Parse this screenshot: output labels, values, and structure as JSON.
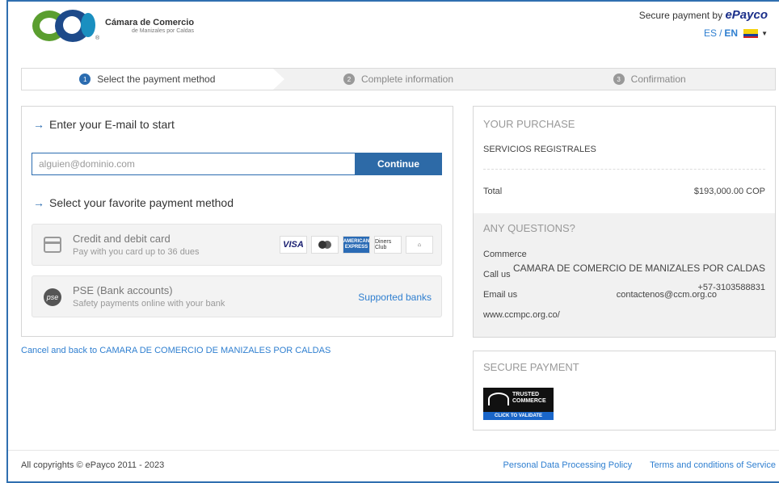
{
  "header": {
    "logo": {
      "name": "Cámara de Comercio",
      "subtitle": "de Manizales por Caldas",
      "reg": "®"
    },
    "secure_prefix": "Secure payment by",
    "secure_brand": "ePayco",
    "lang_es": "ES",
    "lang_sep": "/",
    "lang_en": "EN",
    "flag_icon": "colombia-flag-icon"
  },
  "steps": [
    {
      "num": "1",
      "label": "Select the payment method",
      "active": true
    },
    {
      "num": "2",
      "label": "Complete information",
      "active": false
    },
    {
      "num": "3",
      "label": "Confirmation",
      "active": false
    }
  ],
  "main": {
    "email_title": "Enter your E-mail to start",
    "email_placeholder": "alguien@dominio.com",
    "continue_label": "Continue",
    "methods_title": "Select your favorite payment method",
    "methods": [
      {
        "title": "Credit and debit card",
        "subtitle": "Pay with you card up to 36 dues",
        "icon": "credit-card-icon",
        "brands": [
          "VISA",
          "Mastercard",
          "AMERICAN EXPRESS",
          "Diners Club",
          "Banco de Occidente"
        ]
      },
      {
        "title": "PSE (Bank accounts)",
        "subtitle": "Safety payments online with your bank",
        "icon": "pse-icon",
        "icon_text": "pse",
        "link": "Supported banks"
      }
    ],
    "cancel_link": "Cancel and back to CAMARA DE COMERCIO DE MANIZALES POR CALDAS"
  },
  "purchase": {
    "title": "YOUR PURCHASE",
    "item": "SERVICIOS REGISTRALES",
    "total_label": "Total",
    "total_value": "$193,000.00 COP"
  },
  "questions": {
    "title": "ANY QUESTIONS?",
    "commerce_label": "Commerce",
    "call_label": "Call us",
    "commerce_name": "CAMARA DE COMERCIO DE MANIZALES POR CALDAS",
    "phone": "+57-3103588831",
    "email_label": "Email us",
    "email": "contactenos@ccm.org.co",
    "website": "www.ccmpc.org.co/"
  },
  "secure": {
    "title": "SECURE PAYMENT",
    "badge_title_1": "TRUSTED",
    "badge_title_2": "COMMERCE",
    "badge_cta": "CLICK TO VALIDATE"
  },
  "footer": {
    "copyright": "All copyrights © ePayco 2011 - 2023",
    "privacy": "Personal Data Processing Policy",
    "terms": "Terms and conditions of Service"
  },
  "colors": {
    "accent": "#2d6aa7",
    "link": "#2f7fd0",
    "logo_green": "#5a9e2f",
    "logo_blue": "#1d4a8a"
  }
}
